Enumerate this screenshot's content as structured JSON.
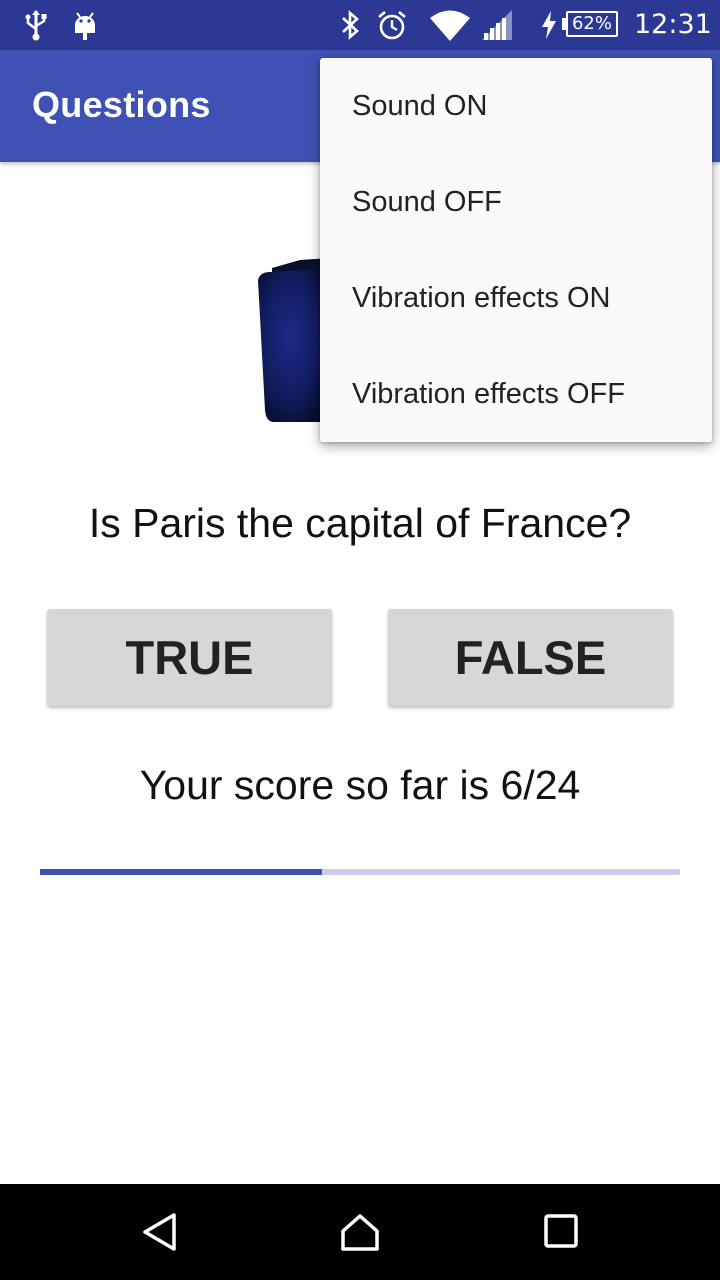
{
  "status_bar": {
    "icons": [
      "usb-icon",
      "android-debug-icon",
      "bluetooth-icon",
      "alarm-icon",
      "wifi-icon",
      "cell-signal-icon",
      "charging-icon",
      "battery-icon"
    ],
    "battery": "62%",
    "time": "12:31"
  },
  "app_bar": {
    "title": "Questions"
  },
  "menu": {
    "items": [
      {
        "label": "Sound ON"
      },
      {
        "label": "Sound OFF"
      },
      {
        "label": "Vibration effects ON"
      },
      {
        "label": "Vibration effects OFF"
      }
    ]
  },
  "question": {
    "text": "Is Paris the capital of France?"
  },
  "buttons": {
    "true_label": "TRUE",
    "false_label": "FALSE"
  },
  "score": {
    "text": "Your score so far is 6/24"
  },
  "progress": {
    "fraction": 0.44
  },
  "navigation": {
    "icons": [
      "back-icon",
      "home-icon",
      "recents-icon"
    ]
  },
  "colors": {
    "primary": "#3f51b5",
    "primary_dark": "#2c3994",
    "button": "#d6d7d7"
  }
}
